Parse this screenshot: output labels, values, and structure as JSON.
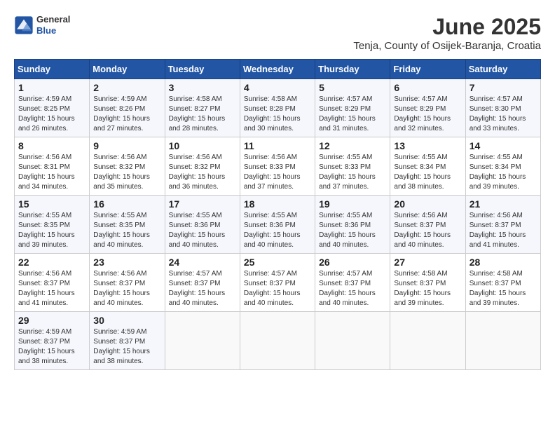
{
  "header": {
    "logo_line1": "General",
    "logo_line2": "Blue",
    "title": "June 2025",
    "subtitle": "Tenja, County of Osijek-Baranja, Croatia"
  },
  "calendar": {
    "days_of_week": [
      "Sunday",
      "Monday",
      "Tuesday",
      "Wednesday",
      "Thursday",
      "Friday",
      "Saturday"
    ],
    "weeks": [
      [
        null,
        {
          "day": "2",
          "sunrise": "4:59 AM",
          "sunset": "8:26 PM",
          "daylight": "15 hours and 27 minutes."
        },
        {
          "day": "3",
          "sunrise": "4:58 AM",
          "sunset": "8:27 PM",
          "daylight": "15 hours and 28 minutes."
        },
        {
          "day": "4",
          "sunrise": "4:58 AM",
          "sunset": "8:28 PM",
          "daylight": "15 hours and 30 minutes."
        },
        {
          "day": "5",
          "sunrise": "4:57 AM",
          "sunset": "8:29 PM",
          "daylight": "15 hours and 31 minutes."
        },
        {
          "day": "6",
          "sunrise": "4:57 AM",
          "sunset": "8:29 PM",
          "daylight": "15 hours and 32 minutes."
        },
        {
          "day": "7",
          "sunrise": "4:57 AM",
          "sunset": "8:30 PM",
          "daylight": "15 hours and 33 minutes."
        }
      ],
      [
        {
          "day": "1",
          "sunrise": "4:59 AM",
          "sunset": "8:25 PM",
          "daylight": "15 hours and 26 minutes."
        },
        null,
        null,
        null,
        null,
        null,
        null
      ],
      [
        {
          "day": "8",
          "sunrise": "4:56 AM",
          "sunset": "8:31 PM",
          "daylight": "15 hours and 34 minutes."
        },
        {
          "day": "9",
          "sunrise": "4:56 AM",
          "sunset": "8:32 PM",
          "daylight": "15 hours and 35 minutes."
        },
        {
          "day": "10",
          "sunrise": "4:56 AM",
          "sunset": "8:32 PM",
          "daylight": "15 hours and 36 minutes."
        },
        {
          "day": "11",
          "sunrise": "4:56 AM",
          "sunset": "8:33 PM",
          "daylight": "15 hours and 37 minutes."
        },
        {
          "day": "12",
          "sunrise": "4:55 AM",
          "sunset": "8:33 PM",
          "daylight": "15 hours and 37 minutes."
        },
        {
          "day": "13",
          "sunrise": "4:55 AM",
          "sunset": "8:34 PM",
          "daylight": "15 hours and 38 minutes."
        },
        {
          "day": "14",
          "sunrise": "4:55 AM",
          "sunset": "8:34 PM",
          "daylight": "15 hours and 39 minutes."
        }
      ],
      [
        {
          "day": "15",
          "sunrise": "4:55 AM",
          "sunset": "8:35 PM",
          "daylight": "15 hours and 39 minutes."
        },
        {
          "day": "16",
          "sunrise": "4:55 AM",
          "sunset": "8:35 PM",
          "daylight": "15 hours and 40 minutes."
        },
        {
          "day": "17",
          "sunrise": "4:55 AM",
          "sunset": "8:36 PM",
          "daylight": "15 hours and 40 minutes."
        },
        {
          "day": "18",
          "sunrise": "4:55 AM",
          "sunset": "8:36 PM",
          "daylight": "15 hours and 40 minutes."
        },
        {
          "day": "19",
          "sunrise": "4:55 AM",
          "sunset": "8:36 PM",
          "daylight": "15 hours and 40 minutes."
        },
        {
          "day": "20",
          "sunrise": "4:56 AM",
          "sunset": "8:37 PM",
          "daylight": "15 hours and 40 minutes."
        },
        {
          "day": "21",
          "sunrise": "4:56 AM",
          "sunset": "8:37 PM",
          "daylight": "15 hours and 41 minutes."
        }
      ],
      [
        {
          "day": "22",
          "sunrise": "4:56 AM",
          "sunset": "8:37 PM",
          "daylight": "15 hours and 41 minutes."
        },
        {
          "day": "23",
          "sunrise": "4:56 AM",
          "sunset": "8:37 PM",
          "daylight": "15 hours and 40 minutes."
        },
        {
          "day": "24",
          "sunrise": "4:57 AM",
          "sunset": "8:37 PM",
          "daylight": "15 hours and 40 minutes."
        },
        {
          "day": "25",
          "sunrise": "4:57 AM",
          "sunset": "8:37 PM",
          "daylight": "15 hours and 40 minutes."
        },
        {
          "day": "26",
          "sunrise": "4:57 AM",
          "sunset": "8:37 PM",
          "daylight": "15 hours and 40 minutes."
        },
        {
          "day": "27",
          "sunrise": "4:58 AM",
          "sunset": "8:37 PM",
          "daylight": "15 hours and 39 minutes."
        },
        {
          "day": "28",
          "sunrise": "4:58 AM",
          "sunset": "8:37 PM",
          "daylight": "15 hours and 39 minutes."
        }
      ],
      [
        {
          "day": "29",
          "sunrise": "4:59 AM",
          "sunset": "8:37 PM",
          "daylight": "15 hours and 38 minutes."
        },
        {
          "day": "30",
          "sunrise": "4:59 AM",
          "sunset": "8:37 PM",
          "daylight": "15 hours and 38 minutes."
        },
        null,
        null,
        null,
        null,
        null
      ]
    ]
  }
}
